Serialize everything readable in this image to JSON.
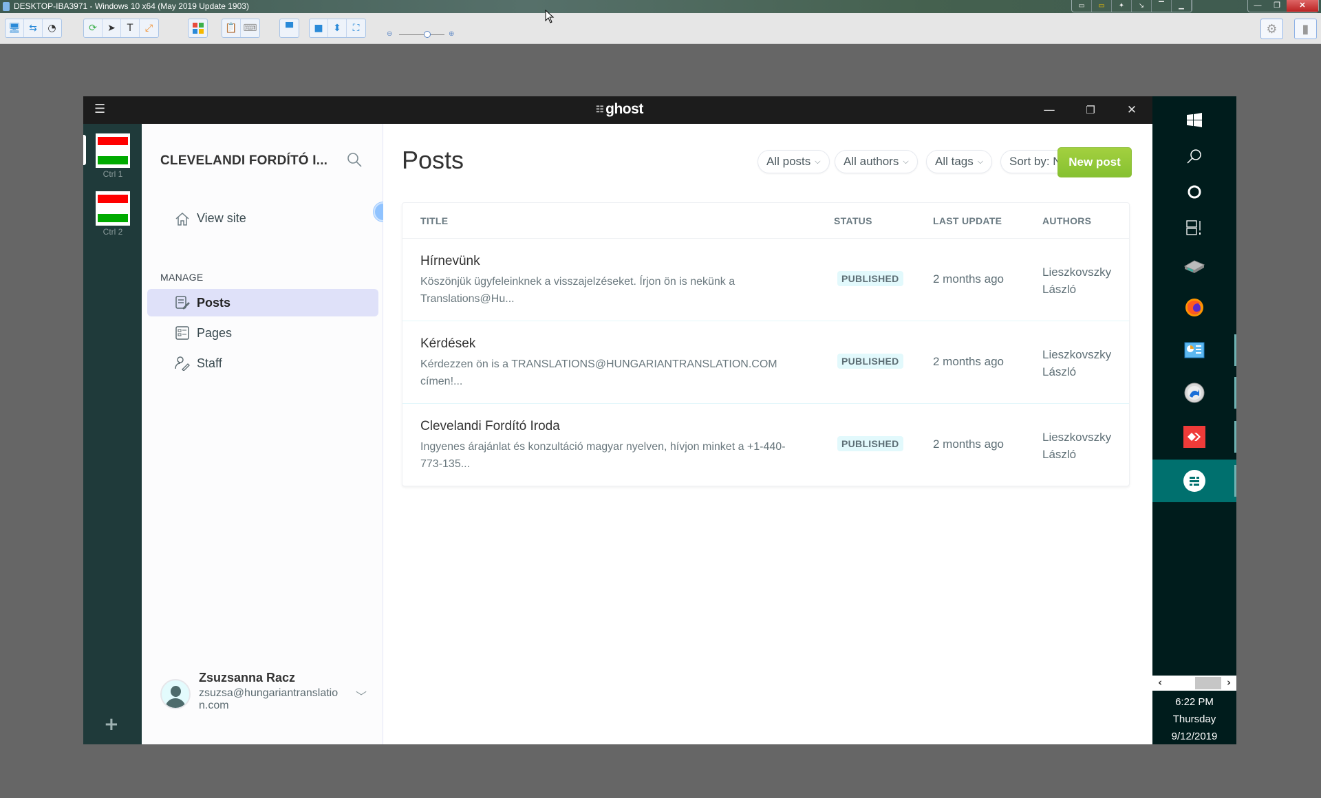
{
  "host": {
    "window_title": "DESKTOP-IBA3971 - Windows 10 x64 (May 2019 Update 1903)"
  },
  "ghost_window": {
    "brand": "ghost",
    "workspaces": [
      {
        "label": "Ctrl 1"
      },
      {
        "label": "Ctrl 2"
      }
    ]
  },
  "sidebar": {
    "site_title": "CLEVELANDI FORDÍTÓ I...",
    "view_site": "View site",
    "manage_heading": "MANAGE",
    "items": [
      {
        "label": "Posts",
        "icon": "posts-icon",
        "active": true
      },
      {
        "label": "Pages",
        "icon": "pages-icon",
        "active": false
      },
      {
        "label": "Staff",
        "icon": "staff-icon",
        "active": false
      }
    ],
    "user": {
      "name": "Zsuzsanna Racz",
      "email": "zsuzsa@hungariantranslation.com"
    }
  },
  "main": {
    "title": "Posts",
    "filters": {
      "posts": "All posts",
      "authors": "All authors",
      "tags": "All tags",
      "sort": "Sort by: Newest"
    },
    "new_post": "New post",
    "table": {
      "headers": {
        "title": "TITLE",
        "status": "STATUS",
        "last_update": "LAST UPDATE",
        "authors": "AUTHORS"
      },
      "rows": [
        {
          "title": "Hírnevünk",
          "excerpt": "Köszönjük ügyfeleinknek a visszajelzéseket. Írjon ön is nekünk a Translations@Hu...",
          "status": "PUBLISHED",
          "last_update": "2 months ago",
          "authors": "Lieszkovszky László"
        },
        {
          "title": "Kérdések",
          "excerpt": "Kérdezzen ön is a TRANSLATIONS@HUNGARIANTRANSLATION.COM címen!...",
          "status": "PUBLISHED",
          "last_update": "2 months ago",
          "authors": "Lieszkovszky László"
        },
        {
          "title": "Clevelandi Fordító Iroda",
          "excerpt": "Ingyenes árajánlat és konzultáció magyar nyelven, hívjon minket a +1-440-773-135...",
          "status": "PUBLISHED",
          "last_update": "2 months ago",
          "authors": "Lieszkovszky László"
        }
      ]
    }
  },
  "taskbar": {
    "time": "6:22 PM",
    "day": "Thursday",
    "date": "9/12/2019"
  },
  "colors": {
    "accent_green": "#9fcf3a",
    "active_nav": "#dfe1f9",
    "published_badge": "#e2f9fc",
    "rail": "#1f3a3a",
    "taskbar": "#001c1c",
    "taskbar_active": "#00706e"
  }
}
